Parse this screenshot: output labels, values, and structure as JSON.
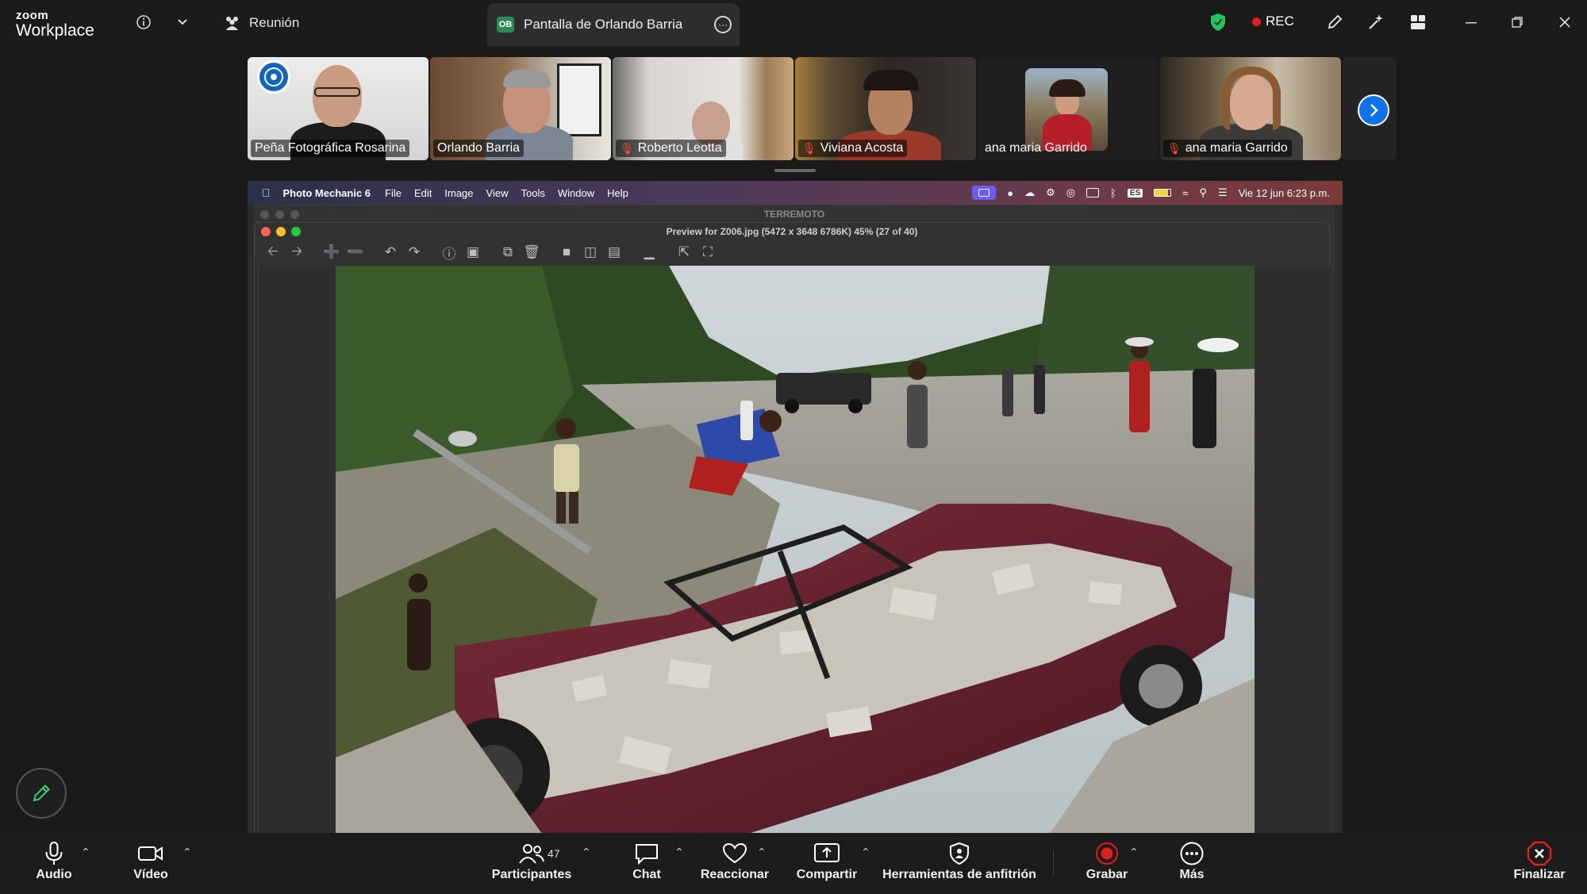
{
  "app": {
    "logo_line1": "zoom",
    "logo_line2": "Workplace"
  },
  "titlebar": {
    "meeting_label": "Reunión",
    "share_tab_initials": "OB",
    "share_tab_label": "Pantalla de Orlando Barria",
    "rec_label": "REC"
  },
  "participants_strip": [
    {
      "name": "Peña Fotográfica Rosarina",
      "muted": false,
      "active": false
    },
    {
      "name": "Orlando Barria",
      "muted": false,
      "active": true
    },
    {
      "name": "Roberto Leotta",
      "muted": true,
      "active": false
    },
    {
      "name": "Viviana Acosta",
      "muted": true,
      "active": false
    },
    {
      "name": "ana maria Garrido",
      "muted": false,
      "active": false
    },
    {
      "name": "ana maria Garrido",
      "muted": true,
      "active": false
    }
  ],
  "shared_screen": {
    "mac_menu": {
      "app_name": "Photo Mechanic 6",
      "items": [
        "File",
        "Edit",
        "Image",
        "View",
        "Tools",
        "Window",
        "Help"
      ],
      "input_badge": "ES",
      "clock": "Vie 12 jun  6:23 p.m."
    },
    "outer_window_title": "TERREMOTO",
    "preview_title": "Preview for Z006.jpg (5472 x 3648 6786K) 45% (27 of 40)"
  },
  "controls": {
    "audio": "Audio",
    "video": "Vídeo",
    "participants": "Participantes",
    "participants_count": "47",
    "chat": "Chat",
    "react": "Reaccionar",
    "share": "Compartir",
    "host_tools": "Herramientas de anfitrión",
    "record": "Grabar",
    "more": "Más",
    "end": "Finalizar"
  },
  "colors": {
    "accent_blue": "#0e72ed",
    "active_speaker": "#3ad36b",
    "record_red": "#e02020",
    "shield_green": "#22c55e"
  }
}
